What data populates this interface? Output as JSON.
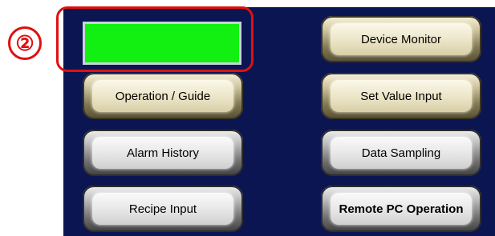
{
  "callout": {
    "number": "②",
    "color": "#e01010"
  },
  "status_indicator": {
    "color": "#11f011"
  },
  "buttons": {
    "device_monitor": "Device Monitor",
    "operation_guide": "Operation / Guide",
    "set_value_input": "Set Value Input",
    "alarm_history": "Alarm History",
    "data_sampling": "Data Sampling",
    "recipe_input": "Recipe Input",
    "remote_pc_operation": "Remote PC Operation"
  },
  "colors": {
    "panel_background": "#0b1552",
    "gold_button": "#d8cfa8",
    "silver_button": "#cfcfcf"
  }
}
